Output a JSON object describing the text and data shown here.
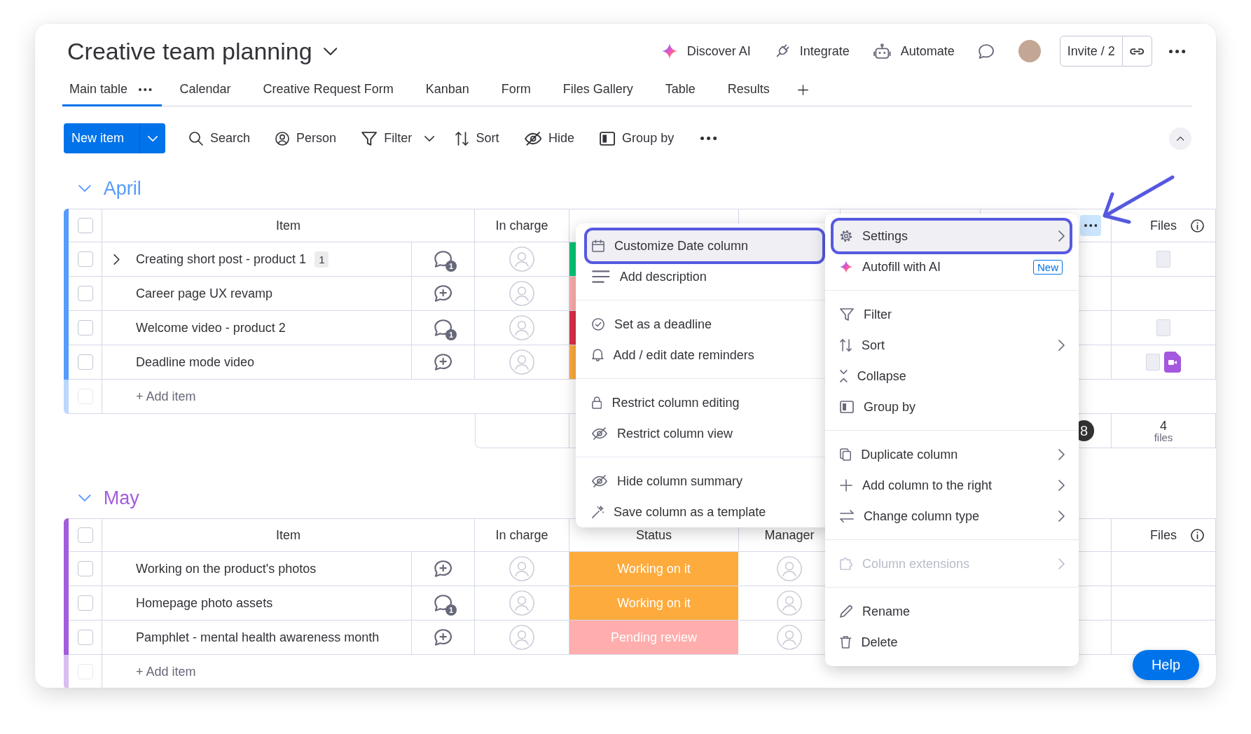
{
  "board": {
    "title": "Creative team planning"
  },
  "header_actions": [
    {
      "label": "Discover AI",
      "kind": "ai"
    },
    {
      "label": "Integrate",
      "kind": "integrate"
    },
    {
      "label": "Automate",
      "kind": "automate"
    }
  ],
  "invite": {
    "label": "Invite / 2"
  },
  "tabs": [
    {
      "label": "Main table",
      "selected": true
    },
    {
      "label": "Calendar",
      "selected": false
    },
    {
      "label": "Creative Request Form",
      "selected": false
    },
    {
      "label": "Kanban",
      "selected": false
    },
    {
      "label": "Form",
      "selected": false
    },
    {
      "label": "Files Gallery",
      "selected": false
    },
    {
      "label": "Table",
      "selected": false
    },
    {
      "label": "Results",
      "selected": false
    }
  ],
  "toolbar": {
    "new_item": "New item",
    "actions": [
      {
        "label": "Search",
        "kind": "search",
        "dropdown": false
      },
      {
        "label": "Person",
        "kind": "person",
        "dropdown": false
      },
      {
        "label": "Filter",
        "kind": "filter",
        "dropdown": true
      },
      {
        "label": "Sort",
        "kind": "sort",
        "dropdown": false
      },
      {
        "label": "Hide",
        "kind": "hide",
        "dropdown": false
      },
      {
        "label": "Group by",
        "kind": "group",
        "dropdown": false
      }
    ]
  },
  "groups": [
    {
      "name": "April",
      "color": "#579bfc",
      "expanded": true,
      "header": {
        "checked": false,
        "item": "Item",
        "in_charge": "In charge",
        "files": "Files"
      },
      "rows": [
        {
          "name": "Creating short post - product 1",
          "checked": false,
          "subitems": "1",
          "updates": "1",
          "status": {
            "color": "#00c875"
          },
          "files": [
            {
              "kind": "image"
            }
          ]
        },
        {
          "name": "Career page UX revamp",
          "checked": false,
          "status": {
            "color": "#ffadad"
          }
        },
        {
          "name": "Welcome video - product 2",
          "checked": false,
          "updates": "1",
          "status": {
            "color": "#df2f4a"
          },
          "files": [
            {
              "kind": "image"
            }
          ]
        },
        {
          "name": "Deadline mode video",
          "checked": false,
          "status": {
            "color": "#fdab3d"
          },
          "files": [
            {
              "kind": "image"
            },
            {
              "kind": "video"
            }
          ]
        }
      ],
      "add_item": {
        "placeholder": "+ Add item",
        "checkbox_disabled": true
      },
      "summary": {
        "badge": "8",
        "files_count": "4",
        "files_unit": "files"
      }
    },
    {
      "name": "May",
      "color": "#a25ddc",
      "expanded": true,
      "header": {
        "checked": false,
        "item": "Item",
        "in_charge": "In charge",
        "status": "Status",
        "manager": "Manager",
        "files": "Files"
      },
      "rows": [
        {
          "name": "Working on the product's photos",
          "checked": false,
          "status": {
            "label": "Working on it",
            "color": "#fdab3d"
          }
        },
        {
          "name": "Homepage photo assets",
          "checked": false,
          "updates": "1",
          "status": {
            "label": "Working on it",
            "color": "#fdab3d"
          }
        },
        {
          "name": "Pamphlet - mental health awareness month",
          "checked": false,
          "status": {
            "label": "Pending review",
            "color": "#ffadad"
          }
        }
      ],
      "add_item": {
        "placeholder": "+ Add item",
        "checkbox_disabled": true
      }
    }
  ],
  "column_menu": {
    "open": true,
    "options": [
      {
        "items": [
          {
            "label": "Customize Date column",
            "kind": "calendar",
            "highlighted": true
          },
          {
            "label": "Add description",
            "kind": "description",
            "highlighted": false
          }
        ]
      },
      {
        "items": [
          {
            "label": "Set as a deadline",
            "kind": "deadline",
            "highlighted": false
          },
          {
            "label": "Add / edit date reminders",
            "kind": "reminder",
            "highlighted": false
          }
        ]
      },
      {
        "items": [
          {
            "label": "Restrict column editing",
            "kind": "lock",
            "highlighted": false
          },
          {
            "label": "Restrict column view",
            "kind": "hidden",
            "highlighted": false
          }
        ]
      },
      {
        "items": [
          {
            "label": "Hide column summary",
            "kind": "hidden",
            "highlighted": false
          },
          {
            "label": "Save column as a template",
            "kind": "template",
            "highlighted": false
          }
        ]
      }
    ],
    "actions": [
      {
        "items": [
          {
            "label": "Settings",
            "kind": "settings",
            "highlighted": true,
            "submenu": true,
            "disabled": false
          },
          {
            "label": "Autofill with AI",
            "kind": "ai",
            "highlighted": false,
            "submenu": false,
            "disabled": false,
            "badge": "New"
          }
        ]
      },
      {
        "items": [
          {
            "label": "Filter",
            "kind": "filter",
            "highlighted": false,
            "submenu": false,
            "disabled": false
          },
          {
            "label": "Sort",
            "kind": "sort",
            "highlighted": false,
            "submenu": true,
            "disabled": false
          },
          {
            "label": "Collapse",
            "kind": "collapse",
            "highlighted": false,
            "submenu": false,
            "disabled": false
          },
          {
            "label": "Group by",
            "kind": "group",
            "highlighted": false,
            "submenu": false,
            "disabled": false
          }
        ]
      },
      {
        "items": [
          {
            "label": "Duplicate column",
            "kind": "duplicate",
            "highlighted": false,
            "submenu": true,
            "disabled": false
          },
          {
            "label": "Add column to the right",
            "kind": "add",
            "highlighted": false,
            "submenu": true,
            "disabled": false
          },
          {
            "label": "Change column type",
            "kind": "change",
            "highlighted": false,
            "submenu": true,
            "disabled": false
          }
        ]
      },
      {
        "items": [
          {
            "label": "Column extensions",
            "kind": "extensions",
            "highlighted": false,
            "submenu": true,
            "disabled": true
          }
        ]
      },
      {
        "items": [
          {
            "label": "Rename",
            "kind": "rename",
            "highlighted": false,
            "submenu": false,
            "disabled": false
          },
          {
            "label": "Delete",
            "kind": "delete",
            "highlighted": false,
            "submenu": false,
            "disabled": false
          }
        ]
      }
    ]
  },
  "help_button": {
    "label": "Help"
  }
}
